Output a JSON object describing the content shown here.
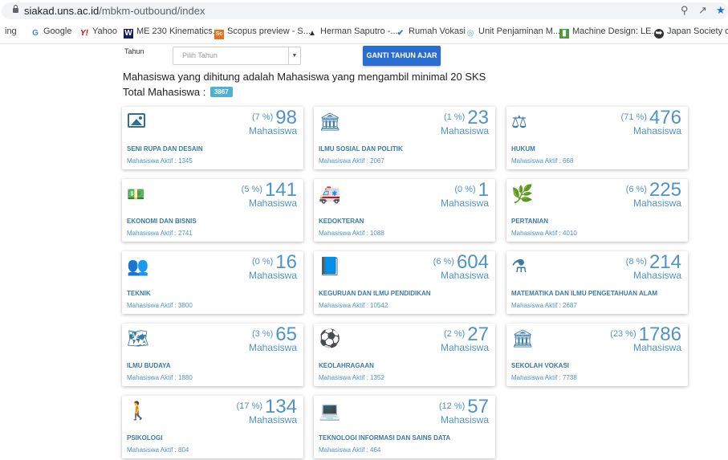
{
  "browser": {
    "url_host": "siakad.uns.ac.id",
    "url_path": "/mbkm-outbound/index",
    "bookmarks": [
      {
        "label": "ing",
        "icon": "bookmark-icon"
      },
      {
        "label": "Google",
        "icon": "google-icon",
        "color": "#4285f4"
      },
      {
        "label": "Yahoo",
        "icon": "yahoo-icon",
        "color": "#d8001a"
      },
      {
        "label": "ME 230 Kinematics...",
        "icon": "w-icon",
        "color": "#1a1a5e"
      },
      {
        "label": "Scopus preview - S...",
        "icon": "scopus-icon",
        "color": "#e9711c"
      },
      {
        "label": "Herman Saputro -...",
        "icon": "scholar-icon",
        "color": "#333333"
      },
      {
        "label": "Rumah Vokasi",
        "icon": "vokasi-icon",
        "color": "#2b7bd4"
      },
      {
        "label": "Unit Penjaminan M...",
        "icon": "globe-icon",
        "color": "#9cc5e8"
      },
      {
        "label": "Machine Design: LE...",
        "icon": "book-icon",
        "color": "#4a9b3a"
      },
      {
        "label": "Japan Society of M",
        "icon": "circle-icon",
        "color": "#333333"
      }
    ]
  },
  "filter": {
    "tahun_label": "Tahun",
    "select_placeholder": "Pilih Tahun",
    "button_label": "GANTI TAHUN AJAR"
  },
  "summary": {
    "note": "Mahasiswa yang dihitung adalah Mahasiswa yang mengambil minimal 20 SKS",
    "total_label": "Total Mahasiswa :",
    "total_value": "3867"
  },
  "cards": [
    {
      "icon": "picture-icon",
      "pct": "(7 %)",
      "count": "98",
      "unit": "Mahasiswa",
      "name": "SENI RUPA DAN DESAIN",
      "aktif": "Mahasiswa Aktif : 1345"
    },
    {
      "icon": "institution-icon",
      "pct": "(1 %)",
      "count": "23",
      "unit": "Mahasiswa",
      "name": "ILMU SOSIAL DAN POLITIK",
      "aktif": "Mahasiswa Aktif : 2067"
    },
    {
      "icon": "balance-scale-icon",
      "pct": "(71 %)",
      "count": "476",
      "unit": "Mahasiswa",
      "name": "HUKUM",
      "aktif": "Mahasiswa Aktif : 668"
    },
    {
      "icon": "money-icon",
      "pct": "(5 %)",
      "count": "141",
      "unit": "Mahasiswa",
      "name": "EKONOMI DAN BISNIS",
      "aktif": "Mahasiswa Aktif : 2741"
    },
    {
      "icon": "ambulance-icon",
      "pct": "(0 %)",
      "count": "1",
      "unit": "Mahasiswa",
      "name": "KEDOKTERAN",
      "aktif": "Mahasiswa Aktif : 1088"
    },
    {
      "icon": "leaf-icon",
      "pct": "(6 %)",
      "count": "225",
      "unit": "Mahasiswa",
      "name": "PERTANIAN",
      "aktif": "Mahasiswa Aktif : 4010"
    },
    {
      "icon": "users-icon",
      "pct": "(0 %)",
      "count": "16",
      "unit": "Mahasiswa",
      "name": "TEKNIK",
      "aktif": "Mahasiswa Aktif : 3800"
    },
    {
      "icon": "book-icon",
      "pct": "(6 %)",
      "count": "604",
      "unit": "Mahasiswa",
      "name": "KEGURUAN DAN ILMU PENDIDIKAN",
      "aktif": "Mahasiswa Aktif : 10542"
    },
    {
      "icon": "flask-icon",
      "pct": "(8 %)",
      "count": "214",
      "unit": "Mahasiswa",
      "name": "MATEMATIKA DAN ILMU PENGETAHUAN ALAM",
      "aktif": "Mahasiswa Aktif : 2687"
    },
    {
      "icon": "map-icon",
      "pct": "(3 %)",
      "count": "65",
      "unit": "Mahasiswa",
      "name": "ILMU BUDAYA",
      "aktif": "Mahasiswa Aktif : 1880"
    },
    {
      "icon": "football-icon",
      "pct": "(2 %)",
      "count": "27",
      "unit": "Mahasiswa",
      "name": "KEOLAHRAGAAN",
      "aktif": "Mahasiswa Aktif : 1352"
    },
    {
      "icon": "institution-icon",
      "pct": "(23 %)",
      "count": "1786",
      "unit": "Mahasiswa",
      "name": "SEKOLAH VOKASI",
      "aktif": "Mahasiswa Aktif : 7738"
    },
    {
      "icon": "child-icon",
      "pct": "(17 %)",
      "count": "134",
      "unit": "Mahasiswa",
      "name": "PSIKOLOGI",
      "aktif": "Mahasiswa Aktif : 804"
    },
    {
      "icon": "laptop-icon",
      "pct": "(12 %)",
      "count": "57",
      "unit": "Mahasiswa",
      "name": "TEKNOLOGI INFORMASI DAN SAINS DATA",
      "aktif": "Mahasiswa Aktif : 464"
    }
  ],
  "colors": {
    "accent": "#2a6dd0",
    "card_text": "#3a7aa6",
    "stat": "#4f93c9",
    "badge": "#4fb0d6"
  }
}
